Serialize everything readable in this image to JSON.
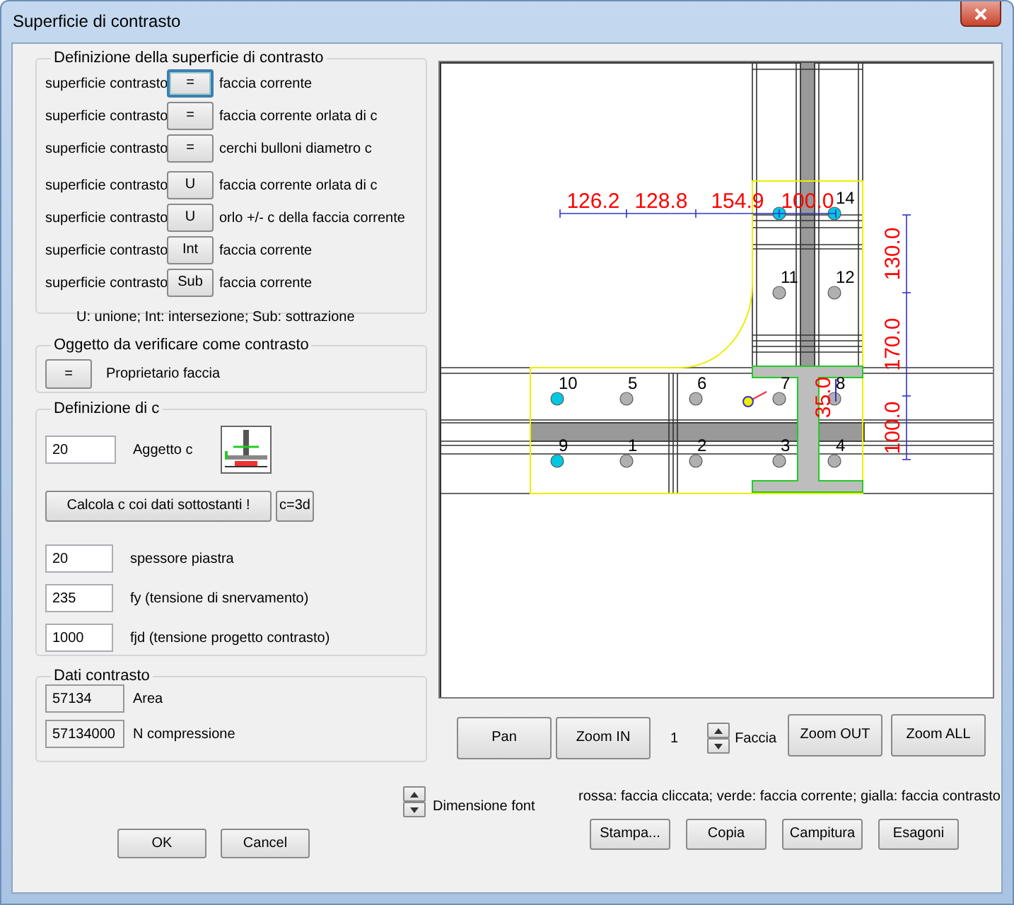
{
  "window": {
    "title": "Superficie di contrasto"
  },
  "surface_group": {
    "legend": "Definizione della superficie di contrasto",
    "rows": [
      {
        "label": "superficie contrasto",
        "button": "=",
        "description": "faccia corrente",
        "selected": true
      },
      {
        "label": "superficie contrasto",
        "button": "=",
        "description": "faccia corrente orlata di c",
        "selected": false
      },
      {
        "label": "superficie contrasto",
        "button": "=",
        "description": "cerchi bulloni diametro c",
        "selected": false
      },
      {
        "label": "superficie contrasto",
        "button": "U",
        "description": "faccia corrente orlata di c",
        "selected": false
      },
      {
        "label": "superficie contrasto",
        "button": "U",
        "description": "orlo +/- c della faccia corrente",
        "selected": false
      },
      {
        "label": "superficie contrasto",
        "button": "Int",
        "description": "faccia corrente",
        "selected": false
      },
      {
        "label": "superficie contrasto",
        "button": "Sub",
        "description": "faccia corrente",
        "selected": false
      }
    ],
    "note": "U: unione; Int: intersezione; Sub: sottrazione"
  },
  "object_group": {
    "legend": "Oggetto da verificare come contrasto",
    "button": "=",
    "label": "Proprietario faccia"
  },
  "c_group": {
    "legend": "Definizione di c",
    "aggetto": {
      "value": "20",
      "label": "Aggetto c"
    },
    "calc_button": "Calcola c coi dati sottostanti !",
    "c3d_button": "c=3d",
    "fields": [
      {
        "value": "20",
        "label": "spessore piastra"
      },
      {
        "value": "235",
        "label": "fy (tensione di snervamento)"
      },
      {
        "value": "1000",
        "label": "fjd (tensione progetto contrasto)"
      }
    ]
  },
  "data_group": {
    "legend": "Dati contrasto",
    "fields": [
      {
        "value": "57134",
        "label": "Area"
      },
      {
        "value": "57134000",
        "label": "N compressione"
      }
    ]
  },
  "drawing": {
    "bolts": [
      {
        "color": "#00c8e0"
      },
      {
        "label": "14",
        "color": "#00c8e0"
      },
      {
        "label": "11",
        "color": "#b0b0b0"
      },
      {
        "label": "12",
        "color": "#b0b0b0"
      },
      {
        "label": "10",
        "color": "#00c8e0"
      },
      {
        "label": "5",
        "color": "#b0b0b0"
      },
      {
        "label": "6",
        "color": "#b0b0b0"
      },
      {
        "label": "7",
        "color": "#b0b0b0"
      },
      {
        "label": "8",
        "color": "#b0b0b0"
      },
      {
        "label": "9",
        "color": "#00c8e0"
      },
      {
        "label": "1",
        "color": "#b0b0b0"
      },
      {
        "label": "2",
        "color": "#b0b0b0"
      },
      {
        "label": "3",
        "color": "#b0b0b0"
      },
      {
        "label": "4",
        "color": "#b0b0b0"
      }
    ],
    "horizontal_dimensions": [
      "126.2",
      "128.8",
      "154.9",
      "100.0"
    ],
    "vertical_dimensions": [
      "130.0",
      "170.0",
      "100.0"
    ],
    "web_dimension": "35.0"
  },
  "view_controls": {
    "pan": "Pan",
    "zoom_in": "Zoom IN",
    "face_number": "1",
    "face_label": "Faccia",
    "zoom_out": "Zoom OUT",
    "zoom_all": "Zoom ALL"
  },
  "font_size_label": "Dimensione font",
  "legend_text": "rossa: faccia cliccata; verde: faccia corrente; gialla: faccia contrasto",
  "action_buttons": [
    "Stampa...",
    "Copia",
    "Campitura",
    "Esagoni"
  ],
  "dialog_buttons": [
    "OK",
    "Cancel"
  ]
}
